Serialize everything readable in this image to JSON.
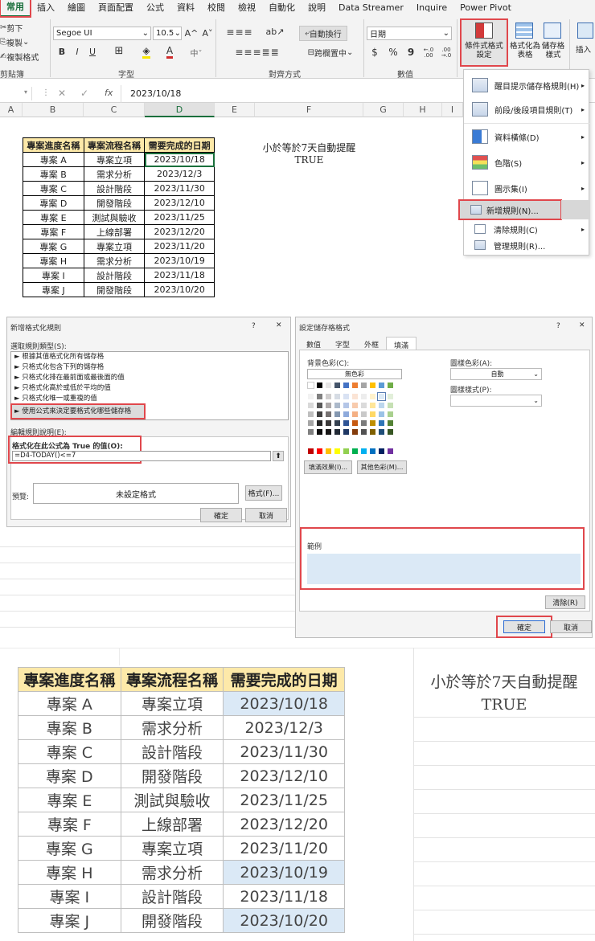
{
  "ribbon": {
    "tabs": [
      "常用",
      "插入",
      "繪圖",
      "頁面配置",
      "公式",
      "資料",
      "校閱",
      "檢視",
      "自動化",
      "說明",
      "Data Streamer",
      "Inquire",
      "Power Pivot"
    ],
    "clipboard": {
      "cut": "剪下",
      "copy": "複製",
      "format_painter": "複製格式",
      "label": "剪貼簿"
    },
    "font": {
      "name": "Segoe UI",
      "size": "10.5",
      "grow": "A^",
      "shrink": "A˅",
      "bold": "B",
      "italic": "I",
      "underline": "U",
      "label": "字型"
    },
    "alignment": {
      "wrap": "自動換行",
      "merge": "跨欄置中",
      "label": "對齊方式"
    },
    "number": {
      "format": "日期",
      "dollar": "$",
      "percent": "%",
      "comma": "9",
      "inc": "←.0 .00",
      "dec": ".00 →.0",
      "label": "數值"
    },
    "styles": {
      "conditional": "條件式格式設定",
      "table": "格式化為表格",
      "cell": "儲存格樣式"
    },
    "insert": "插入"
  },
  "menu": {
    "items": [
      {
        "label": "醒目提示儲存格規則(H)",
        "arrow": "▸"
      },
      {
        "label": "前段/後段項目規則(T)",
        "arrow": "▸"
      },
      {
        "label": "資料橫條(D)",
        "arrow": "▸"
      },
      {
        "label": "色階(S)",
        "arrow": "▸"
      },
      {
        "label": "圖示集(I)",
        "arrow": "▸"
      },
      {
        "label": "新增規則(N)...",
        "arrow": ""
      },
      {
        "label": "清除規則(C)",
        "arrow": "▸"
      },
      {
        "label": "管理規則(R)...",
        "arrow": ""
      }
    ]
  },
  "formula_bar": {
    "name_box": "",
    "cancel": "✕",
    "enter": "✓",
    "fx": "fx",
    "value": "2023/10/18"
  },
  "columns": [
    "A",
    "B",
    "C",
    "D",
    "E",
    "F",
    "G",
    "H",
    "I"
  ],
  "sheet": {
    "headers": [
      "專案進度名稱",
      "專案流程名稱",
      "需要完成的日期"
    ],
    "rows": [
      [
        "專案 A",
        "專案立項",
        "2023/10/18"
      ],
      [
        "專案 B",
        "需求分析",
        "2023/12/3"
      ],
      [
        "專案 C",
        "設計階段",
        "2023/11/30"
      ],
      [
        "專案 D",
        "開發階段",
        "2023/12/10"
      ],
      [
        "專案 E",
        "測試與驗收",
        "2023/11/25"
      ],
      [
        "專案 F",
        "上線部署",
        "2023/12/20"
      ],
      [
        "專案 G",
        "專案立項",
        "2023/11/20"
      ],
      [
        "專案 H",
        "需求分析",
        "2023/10/19"
      ],
      [
        "專案 I",
        "設計階段",
        "2023/11/18"
      ],
      [
        "專案 J",
        "開發階段",
        "2023/10/20"
      ]
    ],
    "note_title": "小於等於7天自動提醒",
    "note_value": "TRUE"
  },
  "rule_dialog": {
    "title": "新增格式化規則",
    "help": "?",
    "close": "✕",
    "select_label": "選取規則類型(S):",
    "types": [
      "► 根據其值格式化所有儲存格",
      "► 只格式化包含下列的儲存格",
      "► 只格式化排在最前面或最後面的值",
      "► 只格式化高於或低於平均的值",
      "► 只格式化唯一或重複的值",
      "► 使用公式來決定要格式化哪些儲存格"
    ],
    "edit_label": "編輯規則說明(E):",
    "formula_label": "格式化在此公式為 True 的值(O):",
    "formula": "=D4-TODAY()<=7",
    "preview_label": "預覽:",
    "preview_text": "未設定格式",
    "format_btn": "格式(F)...",
    "ok": "確定",
    "cancel": "取消"
  },
  "format_dialog": {
    "title": "設定儲存格格式",
    "help": "?",
    "close": "✕",
    "tabs": [
      "數值",
      "字型",
      "外框",
      "填滿"
    ],
    "bg_label": "背景色彩(C):",
    "no_color": "無色彩",
    "pattern_color_label": "圖樣色彩(A):",
    "pattern_color": "自動",
    "pattern_style_label": "圖樣樣式(P):",
    "fill_effects": "填滿效果(I)...",
    "more_colors": "其他色彩(M)...",
    "sample_label": "範例",
    "clear": "清除(R)",
    "ok": "確定",
    "cancel": "取消",
    "sample_color": "#dbe9f6"
  },
  "colors": {
    "accent": "#1a6f3c",
    "highlight": "#e0474c",
    "header_fill": "#fde9a9",
    "result_fill": "#dbe9f6"
  }
}
